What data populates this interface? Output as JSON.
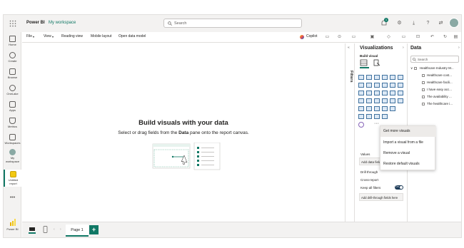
{
  "app": {
    "brand": "Power BI",
    "workspace": "My workspace"
  },
  "search": {
    "placeholder": "Search"
  },
  "topbar": {
    "notification_count": "1"
  },
  "rail": [
    {
      "label": "Home",
      "icon": "home-icon"
    },
    {
      "label": "Create",
      "icon": "create-icon"
    },
    {
      "label": "Browse",
      "icon": "browse-icon"
    },
    {
      "label": "OneLake",
      "icon": "onelake-icon"
    },
    {
      "label": "Apps",
      "icon": "apps-icon"
    },
    {
      "label": "Metrics",
      "icon": "metrics-icon"
    },
    {
      "label": "Workspaces",
      "icon": "workspaces-icon"
    },
    {
      "label": "My workspace",
      "icon": "my-workspace-icon"
    },
    {
      "label": "Untitled report",
      "icon": "report-icon"
    }
  ],
  "rail_bottom": {
    "label": "Power BI"
  },
  "ribbon": {
    "file": "File",
    "view": "View",
    "reading_view": "Reading view",
    "mobile_layout": "Mobile layout",
    "open_data_model": "Open data model",
    "copilot": "Copilot"
  },
  "canvas": {
    "heading": "Build visuals with your data",
    "sub_prefix": "Select or drag fields from the ",
    "sub_bold": "Data",
    "sub_suffix": " pane onto the report canvas."
  },
  "filters": {
    "label": "Filters"
  },
  "visualizations": {
    "title": "Visualizations",
    "build_visual": "Build visual",
    "values": "Values",
    "add_data_fields": "Add data field",
    "drill_through": "Drill through",
    "cross_report": "Cross-report",
    "keep_all_filters": "Keep all filters",
    "keep_all_filters_toggle": "On",
    "add_drill_through": "Add drill-through fields here"
  },
  "data_pane": {
    "title": "Data",
    "search_placeholder": "Search",
    "table": "Healthcare Industry M...",
    "fields": [
      "Healthcare cost...",
      "Healthcare facili...",
      "I have easy acc...",
      "The availability ...",
      "The healthcare i..."
    ]
  },
  "context_menu": {
    "items": [
      "Get more visuals",
      "Import a visual from a file",
      "Remove a visual",
      "Restore default visuals"
    ],
    "highlighted_index": 0
  },
  "pages": {
    "tabs": [
      "Page 1"
    ],
    "add_label": "+"
  },
  "colors": {
    "brand_yellow": "#f2c811",
    "accent_green": "#117865",
    "toggle_dark": "#1b3a57"
  }
}
